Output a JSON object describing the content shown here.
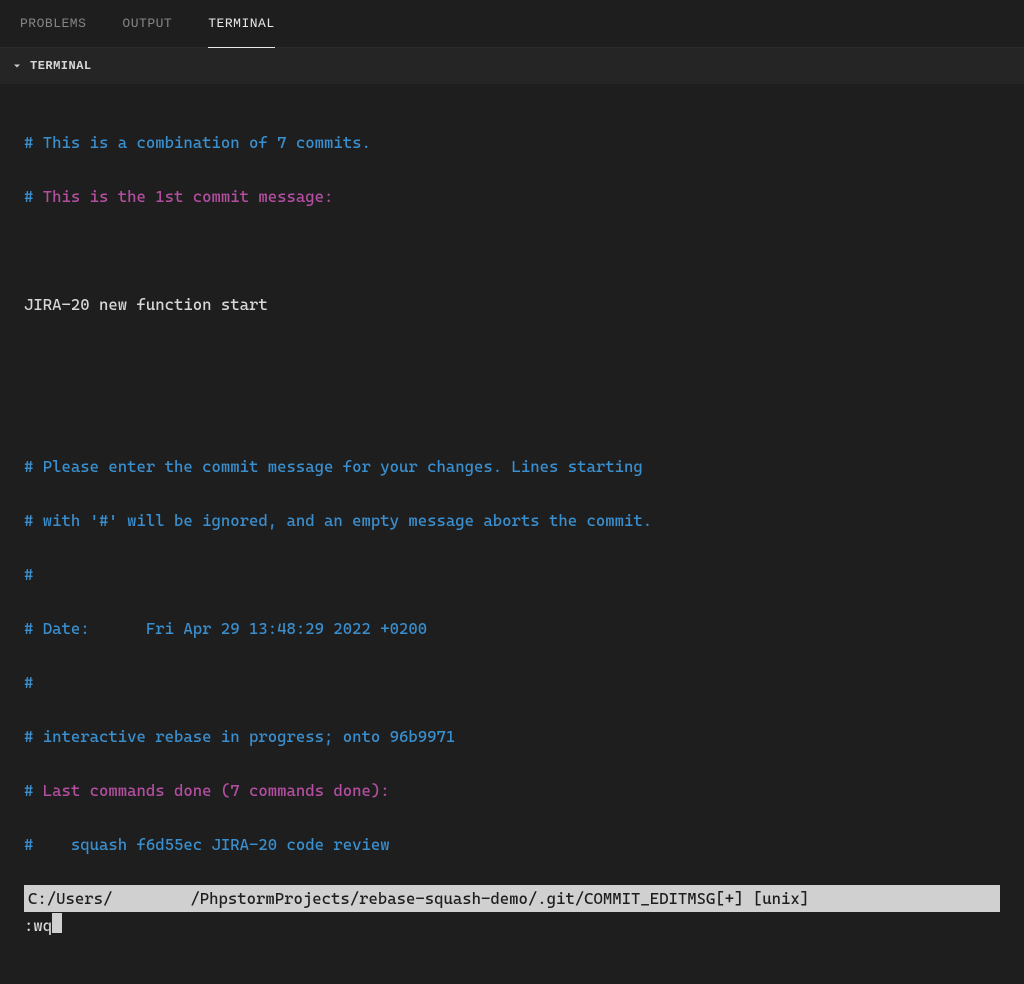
{
  "tabs": {
    "problems": "PROBLEMS",
    "output": "OUTPUT",
    "terminal": "TERMINAL"
  },
  "section": {
    "title": "TERMINAL"
  },
  "lines": {
    "l1_hash": "# ",
    "l1_text": "This is a combination of 7 commits.",
    "l2_hash": "# ",
    "l2_text": "This is the 1st commit message:",
    "l4_text": "JIRA-20 new function start",
    "l7_text": "# Please enter the commit message for your changes. Lines starting",
    "l8_text": "# with '#' will be ignored, and an empty message aborts the commit.",
    "l9_text": "#",
    "l10_text": "# Date:      Fri Apr 29 13:48:29 2022 +0200",
    "l11_text": "#",
    "l12_text": "# interactive rebase in progress; onto 96b9971",
    "l13_hash": "# ",
    "l13_text": "Last commands done (7 commands done):",
    "l14_text": "#    squash f6d55ec JIRA-20 code review",
    "status_prefix": "C:/Users/",
    "status_suffix": "/PhpstormProjects/rebase-squash-demo/.git/COMMIT_EDITMSG[+] [unix]",
    "cmd": ":wq"
  }
}
